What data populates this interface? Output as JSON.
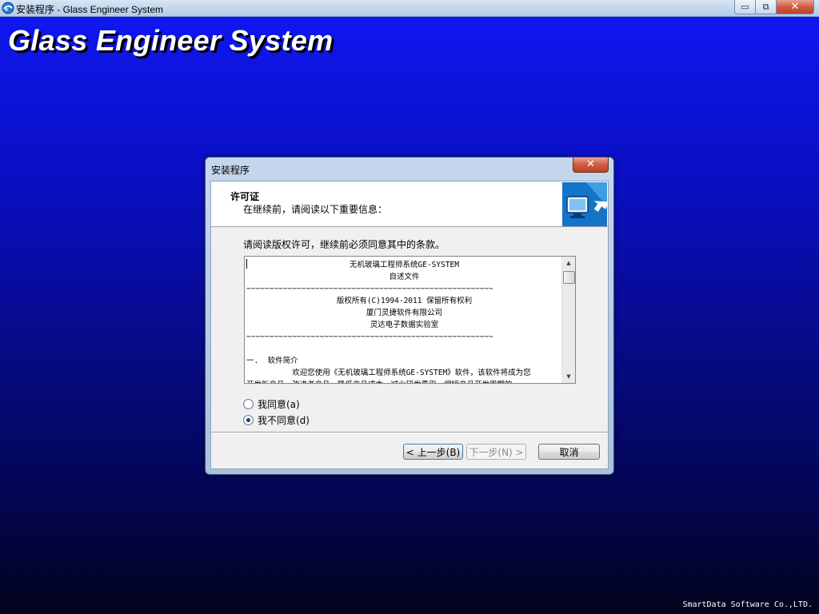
{
  "window": {
    "title": "安装程序 - Glass Engineer System",
    "minimize_glyph": "▭",
    "restore_glyph": "⧉",
    "close_glyph": "✕"
  },
  "banner": {
    "title": "Glass Engineer System",
    "copyright": "SmartData Software Co.,LTD."
  },
  "dialog": {
    "title": "安装程序",
    "close_glyph": "✕",
    "header": {
      "title": "许可证",
      "subtitle": "在继续前，请阅读以下重要信息："
    },
    "instruction": "请阅读版权许可，继续前必须同意其中的条款。",
    "license_lines": [
      {
        "text": "无机玻璃工程师系统GE-SYSTEM",
        "align": "center"
      },
      {
        "text": "自述文件",
        "align": "center"
      },
      {
        "text": "~~~~~~~~~~~~~~~~~~~~~~~~~~~~~~~~~~~~~~~~~~~~~~~~~~~~~~",
        "align": "left"
      },
      {
        "text": "版权所有(C)1994-2011 保留所有权利",
        "align": "center"
      },
      {
        "text": "厦门灵捷软件有限公司",
        "align": "center"
      },
      {
        "text": "灵达电子数据实验室",
        "align": "center"
      },
      {
        "text": "~~~~~~~~~~~~~~~~~~~~~~~~~~~~~~~~~~~~~~~~~~~~~~~~~~~~~~",
        "align": "left"
      },
      {
        "text": "",
        "align": "left"
      },
      {
        "text": "一.  软件简介",
        "align": "left"
      },
      {
        "text": "          欢迎您使用《无机玻璃工程师系统GE-SYSTEM》软件，该软件将成为您",
        "align": "left"
      },
      {
        "text": "开发新产品，改进老产品，降低产品成本，减少研发费用，缩短产品开发周期的",
        "align": "left"
      }
    ],
    "options": {
      "agree": "我同意(a)",
      "disagree": "我不同意(d)",
      "selected": "disagree"
    },
    "buttons": {
      "back": "< 上一步(B)",
      "next": "下一步(N) >",
      "cancel": "取消"
    },
    "scroll_arrows": {
      "up": "▲",
      "down": "▼"
    }
  },
  "colors": {
    "background_top": "#1018f4",
    "background_bottom": "#02031c",
    "title_text": "#ffffff",
    "close_red": "#c14327"
  }
}
